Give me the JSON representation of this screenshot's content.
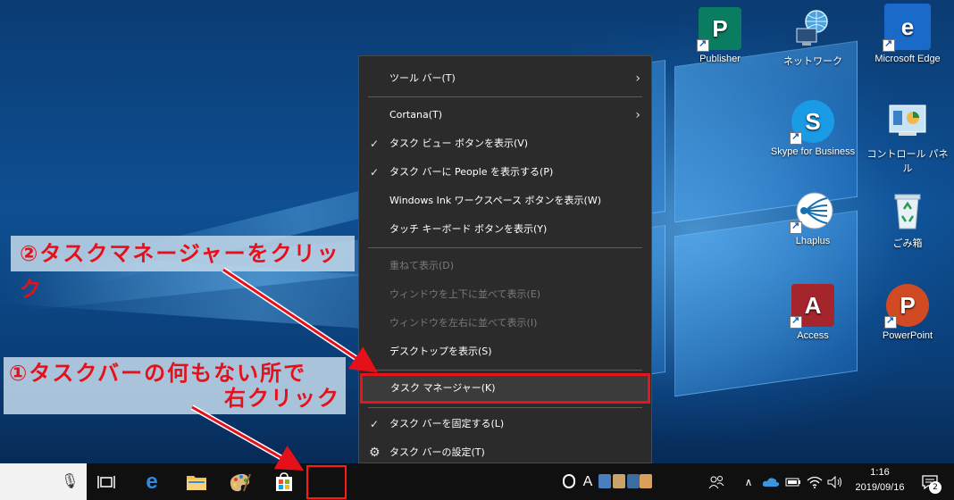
{
  "desktop_icons": [
    {
      "label": "Publisher",
      "glyph": "P",
      "color": "#0a7d60"
    },
    {
      "label": "ネットワーク",
      "glyph": "",
      "color": ""
    },
    {
      "label": "Microsoft Edge",
      "glyph": "e",
      "color": "#1a6ac9"
    },
    {
      "label": "Skype for Business",
      "glyph": "S",
      "color": "#1a9be6"
    },
    {
      "label": "コントロール パネル",
      "glyph": "",
      "color": ""
    },
    {
      "label": "Lhaplus",
      "glyph": "",
      "color": ""
    },
    {
      "label": "ごみ箱",
      "glyph": "",
      "color": ""
    },
    {
      "label": "Access",
      "glyph": "A",
      "color": "#a4262c"
    },
    {
      "label": "PowerPoint",
      "glyph": "P",
      "color": "#d04a24"
    }
  ],
  "context_menu": {
    "items": [
      {
        "label": "ツール バー(T)",
        "state": "submenu"
      },
      {
        "label": "Cortana(T)",
        "state": "submenu"
      },
      {
        "label": "タスク ビュー ボタンを表示(V)",
        "state": "checked"
      },
      {
        "label": "タスク バーに People を表示する(P)",
        "state": "checked"
      },
      {
        "label": "Windows Ink ワークスペース ボタンを表示(W)",
        "state": "normal"
      },
      {
        "label": "タッチ キーボード ボタンを表示(Y)",
        "state": "normal"
      },
      {
        "label": "重ねて表示(D)",
        "state": "disabled"
      },
      {
        "label": "ウィンドウを上下に並べて表示(E)",
        "state": "disabled"
      },
      {
        "label": "ウィンドウを左右に並べて表示(I)",
        "state": "disabled"
      },
      {
        "label": "デスクトップを表示(S)",
        "state": "normal"
      },
      {
        "label": "タスク マネージャー(K)",
        "state": "highlighted"
      },
      {
        "label": "タスク バーを固定する(L)",
        "state": "checked"
      },
      {
        "label": "タスク バーの設定(T)",
        "state": "settings"
      }
    ]
  },
  "annotations": {
    "step2": "②タスクマネージャーをクリック",
    "step1_line1": "①タスクバーの何もない所で",
    "step1_line2": "右クリック",
    "color": "#e5101a"
  },
  "taskbar": {
    "time": "1:16",
    "date": "2019/09/16",
    "notification_count": "2",
    "ime_glyph": "A"
  }
}
